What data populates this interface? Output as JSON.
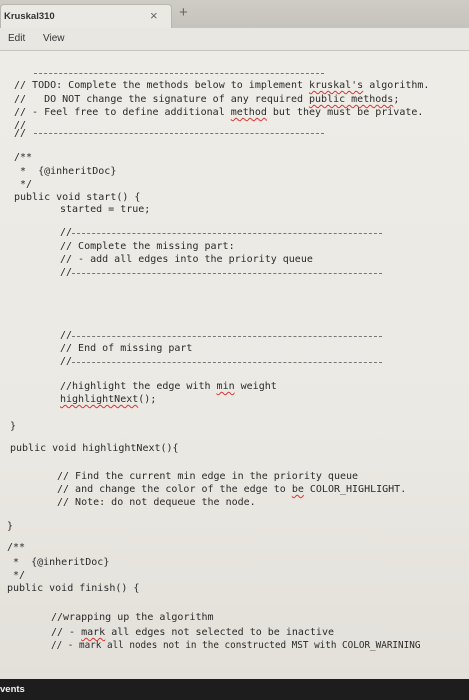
{
  "window": {
    "tab_title": "Kruskal310",
    "close_symbol": "×",
    "new_tab_symbol": "+"
  },
  "menu": {
    "edit": "Edit",
    "view": "View"
  },
  "code": {
    "line_todo": "// TODO: Complete the methods below to implement ",
    "kruskals": "kruskal's",
    "line_todo_end": " algorithm.",
    "line_dont_change": "//   DO NOT change the signature of any required ",
    "public_methods": "public methods",
    "semicolon": ";",
    "line_feel_free": "// - Feel free to define additional ",
    "method": "method",
    "line_feel_free_end": " but they must be private.",
    "slashes": "//",
    "doc_open": "/**",
    "inherit_doc_1": " *  {@inheritDoc}",
    "doc_close": " */",
    "start_sig": "public void start() {",
    "started_true": "started = true;",
    "complete_missing": "// Complete the missing part:",
    "add_edges": "// - add all edges into the priority queue",
    "end_missing": "// End of missing part",
    "highlight_comment_pre": "//highlight the edge with ",
    "min": "min",
    "highlight_comment_post": " weight",
    "highlight_call": "highlightNext",
    "highlight_call_end": "();",
    "close_brace": "}",
    "highlight_sig": "public void highlightNext(){",
    "find_current": "// Find the current min edge in the priority queue",
    "change_color_pre": "// and change the color of the edge to ",
    "be": "be",
    "change_color_post": " COLOR_HIGHLIGHT.",
    "note": "// Note: do not dequeue the node.",
    "inherit_doc_2": " *  {@inheritDoc}",
    "finish_sig": "public void finish() {",
    "wrapping": "//wrapping up the algorithm",
    "mark_pre": "// - ",
    "mark": "mark",
    "mark_post": " all edges not selected to be inactive",
    "mark_nodes": "// - mark all nodes not in the constructed MST with COLOR_WARINING"
  },
  "status": {
    "text": "vents"
  }
}
